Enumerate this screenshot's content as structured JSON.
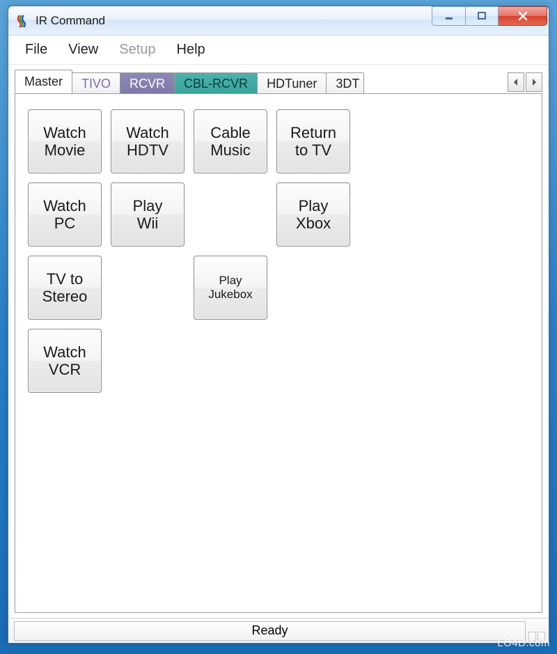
{
  "window": {
    "title": "IR Command"
  },
  "menu": {
    "file": "File",
    "view": "View",
    "setup": "Setup",
    "help": "Help"
  },
  "tabs": [
    {
      "label": "Master",
      "active": true,
      "color": null
    },
    {
      "label": "TIVO",
      "active": false,
      "color": "#7d69b8"
    },
    {
      "label": "RCVR",
      "active": false,
      "color": "#7e7aa8"
    },
    {
      "label": "CBL-RCVR",
      "active": false,
      "color": "#3aa39b"
    },
    {
      "label": "HDTuner",
      "active": false,
      "color": null
    },
    {
      "label": "3DT",
      "active": false,
      "color": null
    }
  ],
  "buttons": {
    "r0c0": "Watch\nMovie",
    "r0c1": "Watch\nHDTV",
    "r0c2": "Cable\nMusic",
    "r0c3": "Return\nto TV",
    "r1c0": "Watch\nPC",
    "r1c1": "Play\nWii",
    "r1c3": "Play\nXbox",
    "r2c0": "TV to\nStereo",
    "r2c2": "Play\nJukebox",
    "r3c0": "Watch\nVCR"
  },
  "status": {
    "text": "Ready"
  },
  "watermark": "LO4D.com"
}
